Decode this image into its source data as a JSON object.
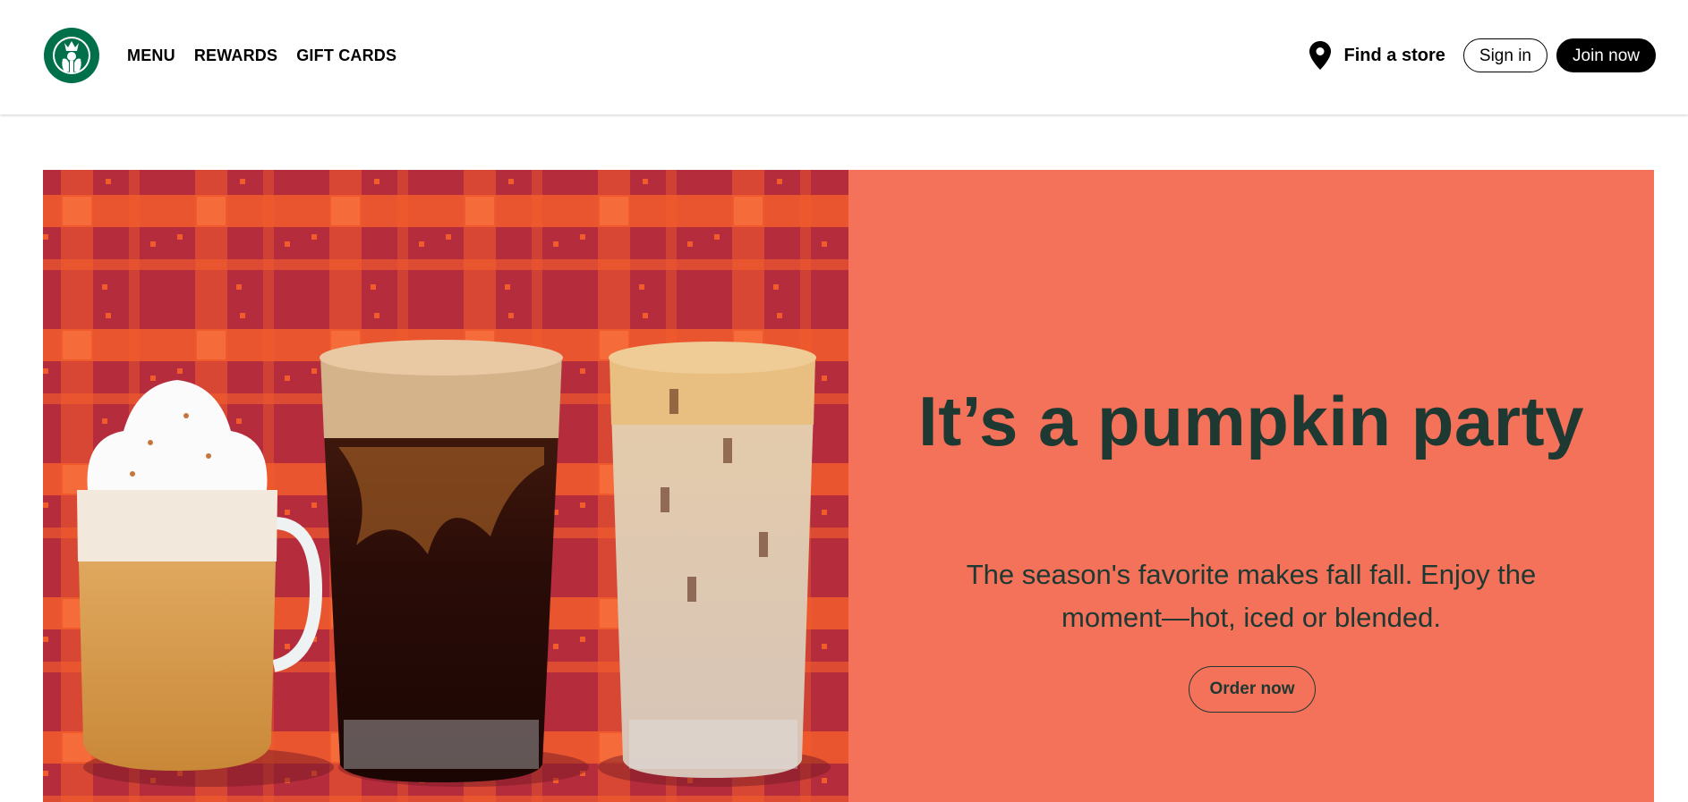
{
  "header": {
    "logo_icon": "starbucks-siren-logo",
    "nav": [
      {
        "label": "MENU"
      },
      {
        "label": "REWARDS"
      },
      {
        "label": "GIFT CARDS"
      }
    ],
    "find_store": {
      "icon": "location-pin-icon",
      "label": "Find a store"
    },
    "sign_in_label": "Sign in",
    "join_label": "Join now"
  },
  "hero": {
    "title": "It’s a pumpkin party",
    "subtitle": "The season's favorite makes fall fall. Enjoy the moment—hot, iced or blended.",
    "cta_label": "Order now",
    "image_description_icon": "pumpkin-drinks-image",
    "colors": {
      "panel_bg": "#f4715a",
      "text": "#1e3932",
      "image_bg": "#b52c3d",
      "plaid": "#f25c2c",
      "brand_green": "#00704a"
    }
  }
}
